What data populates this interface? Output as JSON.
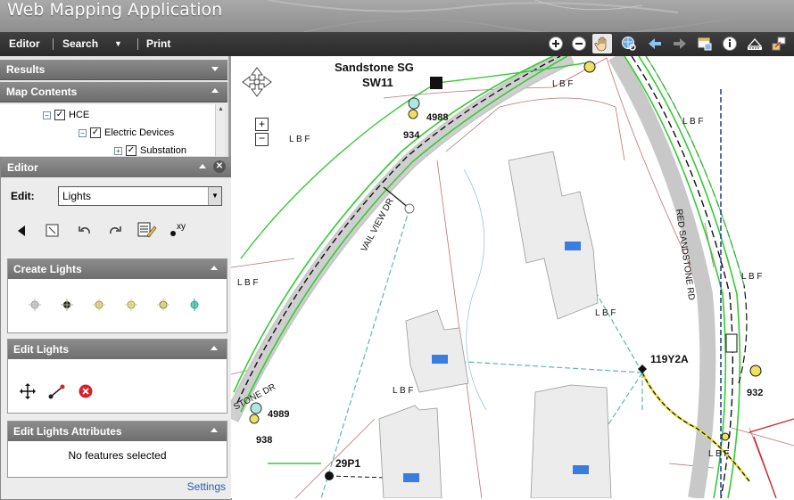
{
  "app": {
    "title": "Web Mapping Application"
  },
  "toolbar": {
    "editor": "Editor",
    "search": "Search",
    "print": "Print"
  },
  "results": {
    "label": "Results"
  },
  "map_contents": {
    "label": "Map Contents",
    "tree": [
      {
        "label": "HCE"
      },
      {
        "label": "Electric Devices"
      },
      {
        "label": "Substation"
      }
    ]
  },
  "editor": {
    "title": "Editor",
    "edit_label": "Edit:",
    "edit_value": "Lights",
    "create_title": "Create Lights",
    "edit_lights_title": "Edit Lights",
    "attr_title": "Edit Lights Attributes",
    "no_features": "No features selected",
    "settings": "Settings",
    "xy_label": "xy"
  },
  "map": {
    "substation_name": "Sandstone SG",
    "substation_id": "SW11",
    "streets": [
      "VAIL VIEW DR",
      "RED SANDSTONE RD",
      "STONE DR"
    ],
    "lbf": "L  B  F",
    "labels": [
      "4988",
      "934",
      "4989",
      "938",
      "29P1",
      "119Y2A",
      "932"
    ]
  },
  "colors": {
    "title_bar": "#999999",
    "toolbar": "#333333",
    "panel_header": "#7a7a7a",
    "green_line": "#33cc33",
    "parcel": "#b04040"
  }
}
